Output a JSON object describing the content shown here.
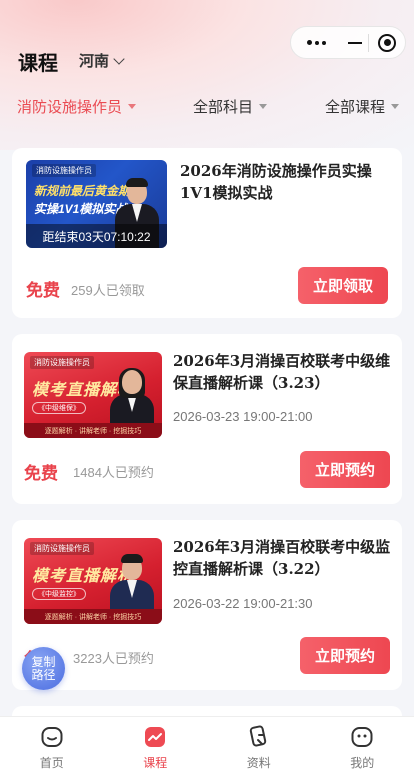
{
  "header": {
    "title": "课程",
    "region": "河南"
  },
  "filters": [
    {
      "label": "消防设施操作员",
      "active": true
    },
    {
      "label": "全部科目",
      "active": false
    },
    {
      "label": "全部课程",
      "active": false
    }
  ],
  "courses": [
    {
      "thumb_tag": "消防设施操作员",
      "thumb_line1": "新规前最后黄金期",
      "thumb_line2": "实操1V1模拟实战",
      "countdown": "距结束03天07:10:22",
      "title": "2026年消防设施操作员实操1V1模拟实战",
      "price": "免费",
      "count": "259人已领取",
      "button": "立即领取"
    },
    {
      "thumb_tag": "消防设施操作员",
      "thumb_big": "模考直播解析",
      "thumb_pill": "《中级维保》",
      "thumb_strip": "逐题解析 · 讲解老师 · 挖掘技巧",
      "title": "2026年3月消操百校联考中级维保直播解析课（3.23）",
      "time": "2026-03-23 19:00-21:00",
      "price": "免费",
      "count": "1484人已预约",
      "button": "立即预约"
    },
    {
      "thumb_tag": "消防设施操作员",
      "thumb_big": "模考直播解析",
      "thumb_pill": "《中级监控》",
      "thumb_strip": "逐题解析 · 讲解老师 · 挖掘技巧",
      "title": "2026年3月消操百校联考中级监控直播解析课（3.22）",
      "time": "2026-03-22 19:00-21:30",
      "price": "免费",
      "count": "3223人已预约",
      "button": "立即预约"
    }
  ],
  "fab": {
    "line1": "复制",
    "line2": "路径"
  },
  "tabbar": [
    {
      "label": "首页",
      "icon": "home-icon",
      "active": false
    },
    {
      "label": "课程",
      "icon": "course-icon",
      "active": true
    },
    {
      "label": "资料",
      "icon": "materials-icon",
      "active": false
    },
    {
      "label": "我的",
      "icon": "profile-icon",
      "active": false
    }
  ],
  "colors": {
    "accent": "#e9434c",
    "fab": "#5d7de6"
  }
}
